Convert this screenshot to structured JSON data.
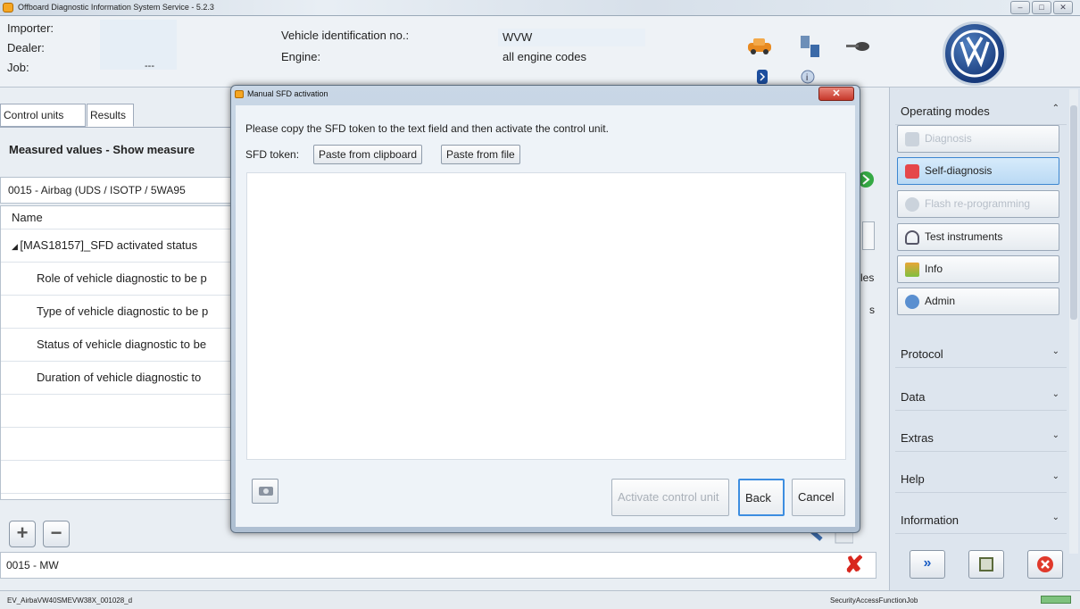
{
  "window": {
    "title": "Offboard Diagnostic Information System Service - 5.2.3",
    "controls": [
      "–",
      "□",
      "✕"
    ]
  },
  "header": {
    "importer_label": "Importer:",
    "dealer_label": "Dealer:",
    "job_label": "Job:",
    "job_value": "---",
    "vin_label": "Vehicle identification no.:",
    "vin_value": "WVW",
    "engine_label": "Engine:",
    "engine_value": "all engine codes"
  },
  "left": {
    "tabs": [
      "Control units",
      "Results"
    ],
    "section_title": "Measured values - Show measure",
    "control_unit": "0015 - Airbag (UDS / ISOTP / 5WA95",
    "column_name": "Name",
    "rows": [
      "[MAS18157]_SFD activated status",
      "Role of vehicle diagnostic to be p",
      "Type of vehicle diagnostic to be p",
      "Status of vehicle diagnostic to be",
      "Duration of vehicle diagnostic to"
    ],
    "behind_les": "les",
    "behind_s": "s",
    "bottom_field": "0015 - MW",
    "plus": "+",
    "minus": "−"
  },
  "sidebar": {
    "operating_modes": "Operating modes",
    "buttons": [
      "Diagnosis",
      "Self-diagnosis",
      "Flash re-programming",
      "Test instruments",
      "Info",
      "Admin"
    ],
    "sections": [
      "Protocol",
      "Data",
      "Extras",
      "Help",
      "Information"
    ]
  },
  "status": {
    "left": "EV_AirbaVW40SMEVW38X_001028_d",
    "right": "SecurityAccessFunctionJob"
  },
  "dialog": {
    "title": "Manual SFD activation",
    "close": "✕",
    "instruction": "Please copy the SFD token to the text field and then activate the control unit.",
    "token_label": "SFD token:",
    "paste_clipboard": "Paste from clipboard",
    "paste_file": "Paste from file",
    "activate": "Activate control unit",
    "back": "Back",
    "cancel": "Cancel"
  },
  "colors": {
    "accent": "#3c86d0",
    "red": "#d8261d"
  }
}
